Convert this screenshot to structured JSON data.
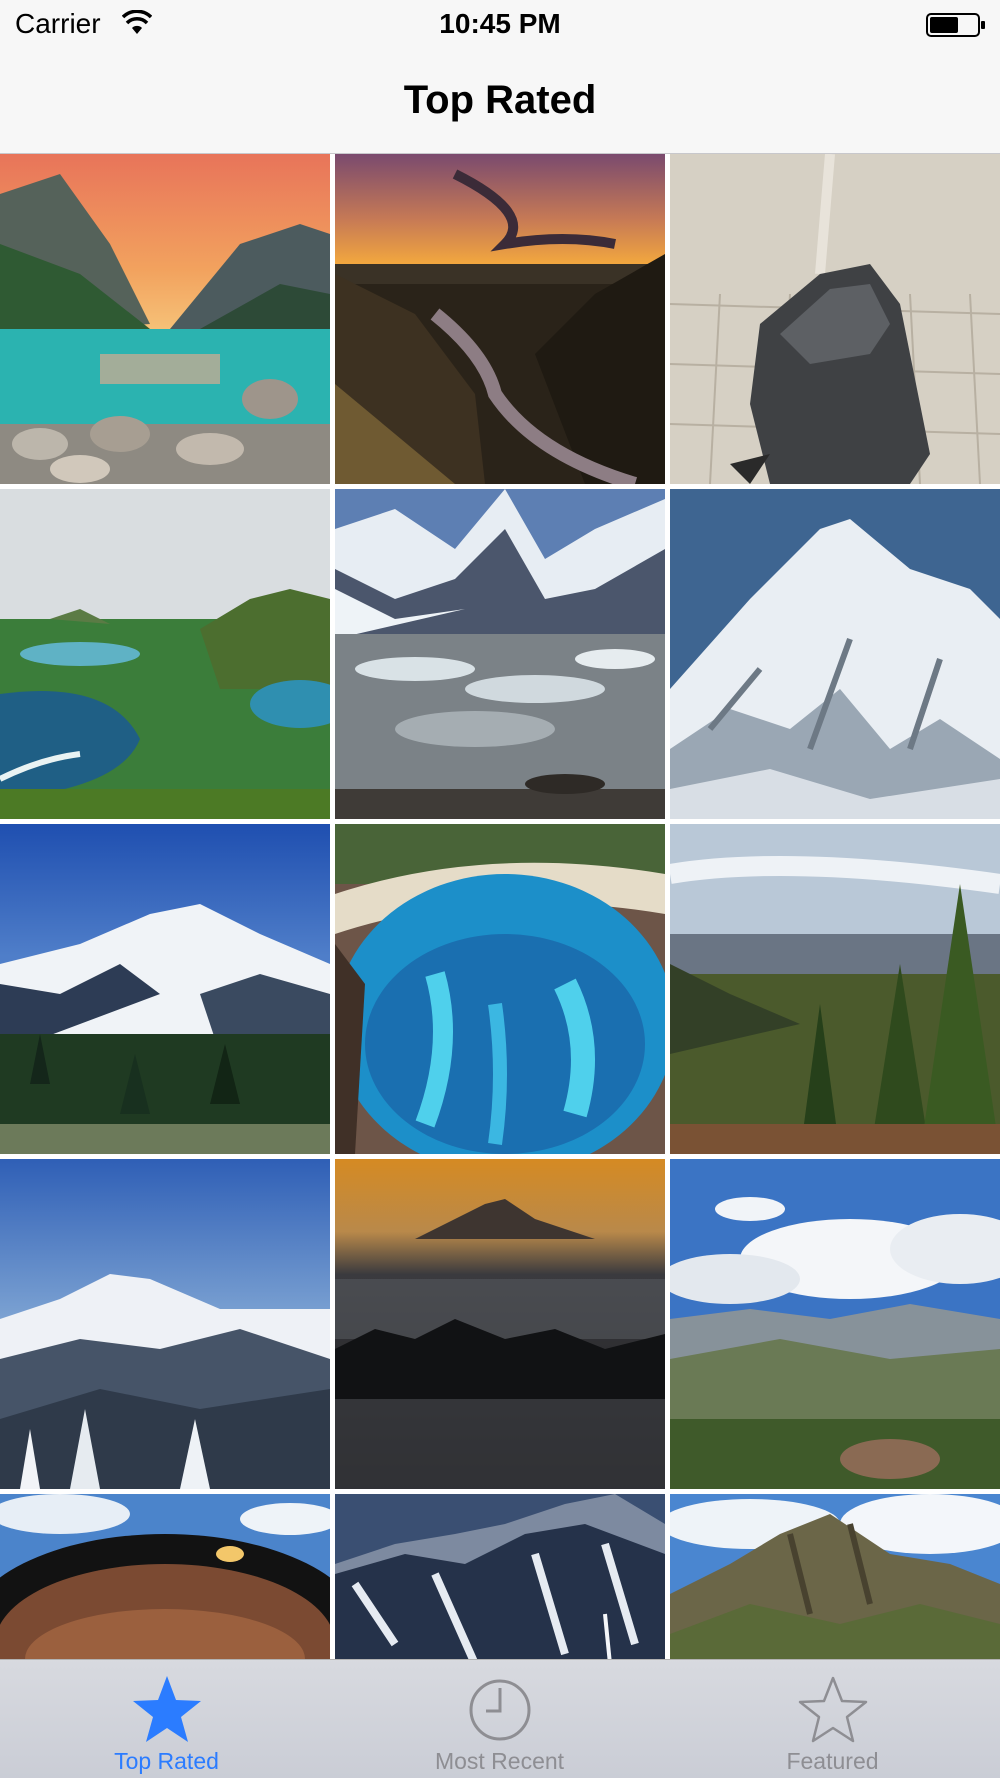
{
  "status_bar": {
    "carrier": "Carrier",
    "time": "10:45 PM",
    "icons": [
      "wifi-icon",
      "battery-icon"
    ]
  },
  "nav": {
    "title": "Top Rated"
  },
  "grid": {
    "columns": 3,
    "photos": [
      {
        "subject": "sunset-lake-mountains"
      },
      {
        "subject": "sunset-river-valley"
      },
      {
        "subject": "rock-on-cracked-playa"
      },
      {
        "subject": "green-coastline-bays"
      },
      {
        "subject": "glacier-lake-peaks"
      },
      {
        "subject": "snowy-mountain-slope"
      },
      {
        "subject": "snowy-peak-forest"
      },
      {
        "subject": "turquoise-reef-aerial"
      },
      {
        "subject": "pine-forest-hillside"
      },
      {
        "subject": "snowy-mountain-range"
      },
      {
        "subject": "peak-above-fog-sunrise"
      },
      {
        "subject": "cloudy-mountain-valley"
      },
      {
        "subject": "blurred-sunglasses-sky"
      },
      {
        "subject": "snowy-cliffs-waterfall"
      },
      {
        "subject": "rocky-peak-clouds"
      }
    ]
  },
  "tab_bar": {
    "active_color": "#2b7cff",
    "inactive_color": "#8e8e93",
    "tabs": [
      {
        "label": "Top Rated",
        "icon": "star-filled-icon",
        "active": true
      },
      {
        "label": "Most Recent",
        "icon": "clock-icon",
        "active": false
      },
      {
        "label": "Featured",
        "icon": "star-outline-icon",
        "active": false
      }
    ]
  }
}
